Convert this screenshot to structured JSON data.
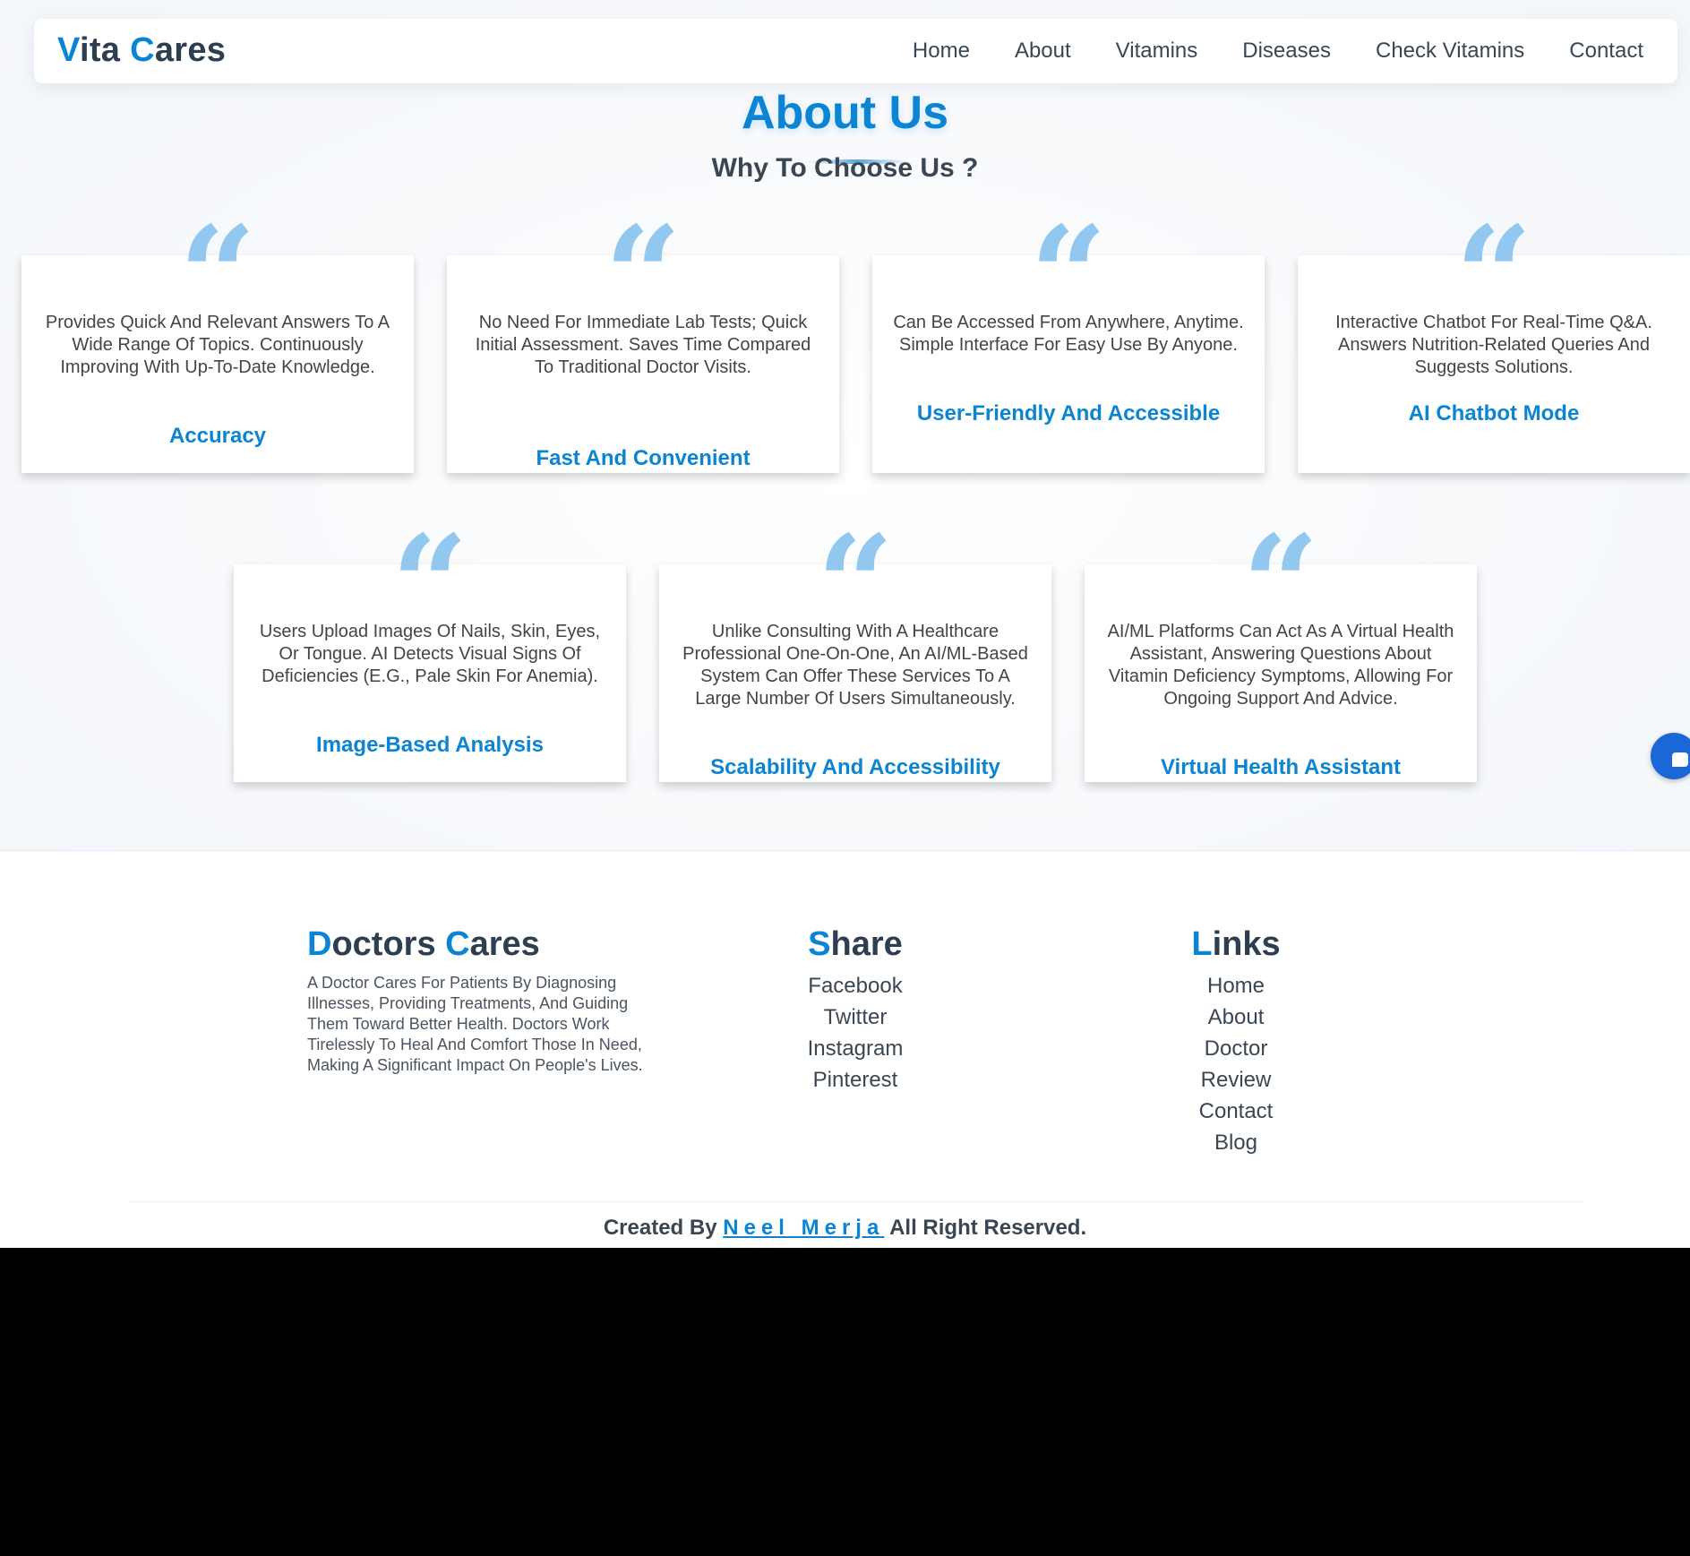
{
  "brand": {
    "accent_color": "#0b84d3",
    "logo_first_letter": "V",
    "logo_rest_1": "ita ",
    "logo_second_letter": "C",
    "logo_rest_2": "ares"
  },
  "nav": {
    "items": [
      "Home",
      "About",
      "Vitamins",
      "Diseases",
      "Check Vitamins",
      "Contact"
    ]
  },
  "about": {
    "title": "About Us",
    "subtitle": "Why To Choose Us ?",
    "quote_glyph": "“",
    "cards": [
      {
        "text": "Provides Quick And Relevant Answers To A Wide Range Of Topics. Continuously Improving With Up-To-Date Knowledge.",
        "title": "Accuracy"
      },
      {
        "text": "No Need For Immediate Lab Tests; Quick Initial Assessment. Saves Time Compared To Traditional Doctor Visits.",
        "title": "Fast And Convenient"
      },
      {
        "text": "Can Be Accessed From Anywhere, Anytime. Simple Interface For Easy Use By Anyone.",
        "title": "User-Friendly And Accessible"
      },
      {
        "text": "Interactive Chatbot For Real-Time Q&A. Answers Nutrition-Related Queries And Suggests Solutions.",
        "title": "AI Chatbot Mode"
      },
      {
        "text": "Users Upload Images Of Nails, Skin, Eyes, Or Tongue. AI Detects Visual Signs Of Deficiencies (E.G., Pale Skin For Anemia).",
        "title": "Image-Based Analysis"
      },
      {
        "text": "Unlike Consulting With A Healthcare Professional One-On-One, An AI/ML-Based System Can Offer These Services To A Large Number Of Users Simultaneously.",
        "title": "Scalability And Accessibility"
      },
      {
        "text": "AI/ML Platforms Can Act As A Virtual Health Assistant, Answering Questions About Vitamin Deficiency Symptoms, Allowing For Ongoing Support And Advice.",
        "title": "Virtual Health Assistant"
      }
    ]
  },
  "footer": {
    "about": {
      "heading_first_letter": "D",
      "heading_rest_1": "octors ",
      "heading_second_letter": "C",
      "heading_rest_2": "ares",
      "description": "A Doctor Cares For Patients By Diagnosing Illnesses, Providing Treatments, And Guiding Them Toward Better Health. Doctors Work Tirelessly To Heal And Comfort Those In Need, Making A Significant Impact On People's Lives."
    },
    "share": {
      "heading_first_letter": "S",
      "heading_rest": "hare",
      "links": [
        "Facebook",
        "Twitter",
        "Instagram",
        "Pinterest"
      ]
    },
    "links": {
      "heading_first_letter": "L",
      "heading_rest": "inks",
      "links": [
        "Home",
        "About",
        "Doctor",
        "Review",
        "Contact",
        "Blog"
      ]
    },
    "credit": {
      "prefix": "Created By ",
      "author": "Neel Merja",
      "suffix": " All Right Reserved."
    }
  },
  "chat_widget": {
    "icon": "chat-bubble-icon"
  }
}
